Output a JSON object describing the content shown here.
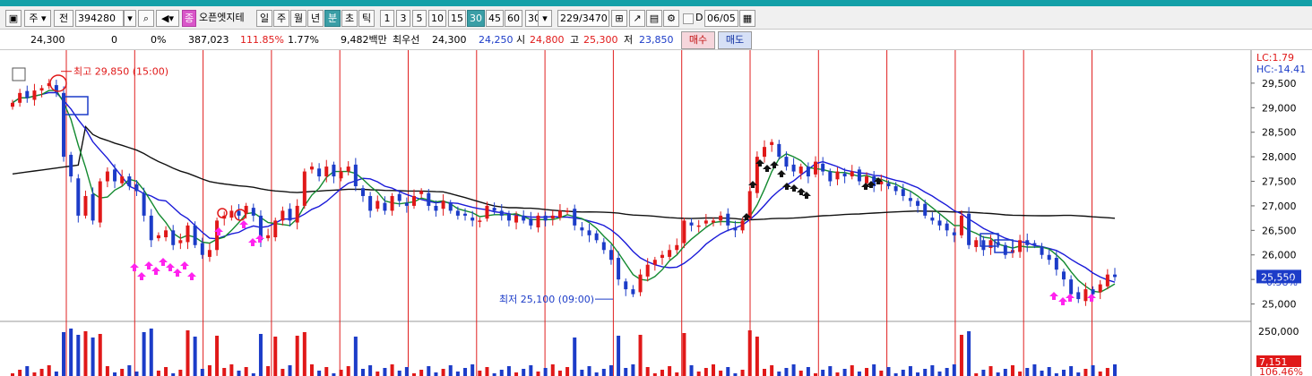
{
  "toolbar": {
    "mode_label": "주",
    "code_type_label": "전",
    "stock_code": "394280",
    "stock_name": "오픈엣지테",
    "badge_label": "종",
    "period_tabs": [
      "일",
      "주",
      "월",
      "년",
      "분",
      "초",
      "틱"
    ],
    "active_period": "분",
    "intervals": [
      "1",
      "3",
      "5",
      "10",
      "15",
      "30",
      "45",
      "60"
    ],
    "active_interval": "30",
    "interval_select_value": "30",
    "count_value": "229",
    "count_total": "/3470",
    "d_label": "D",
    "date_value": "06/05"
  },
  "quote": {
    "price": "24,300",
    "change": "0",
    "change_pct": "0%",
    "volume": "387,023",
    "volume_ratio": "111.85%",
    "turnover": "1.77%",
    "amount": "9,482백만",
    "priority_label": "최우선",
    "ask": "24,300",
    "bid": "24,250",
    "open_label": "시",
    "open": "24,800",
    "high_label": "고",
    "high": "25,300",
    "low_label": "저",
    "low": "23,850",
    "buy_label": "매수",
    "sell_label": "매도"
  },
  "colors": {
    "up": "#e01818",
    "down": "#1c3cc8",
    "accent": "#3a9ea6",
    "ma_short": "#138a30",
    "ma_mid": "#1a1ad8",
    "ma_long": "#111111",
    "signal": "#ff22ee"
  },
  "chart_data": {
    "type": "candlestick",
    "y_axis_ticks": [
      "29,500",
      "29,000",
      "28,500",
      "28,000",
      "27,500",
      "27,000",
      "26,500",
      "26,000",
      "25,500",
      "25,000"
    ],
    "ylim": [
      24700,
      30100
    ],
    "legend_lc": "LC:1.79",
    "legend_hc": "HC:-14.41",
    "current_price_label": "25,550",
    "current_change_label": "-0.58%",
    "current_price": 25550,
    "high_annotation": "최고 29,850 (15:00)",
    "high_value": 29850,
    "low_annotation": "최저 25,100 (09:00)",
    "low_value": 25100,
    "series": [
      {
        "name": "close",
        "values": [
          29100,
          29300,
          29200,
          29350,
          29400,
          29500,
          29300,
          28000,
          27600,
          26800,
          27200,
          26700,
          27500,
          27700,
          27500,
          27600,
          27400,
          27300,
          26800,
          26300,
          26400,
          26500,
          26200,
          26300,
          26600,
          26200,
          26000,
          26100,
          26700,
          26800,
          26900,
          26800,
          27000,
          26800,
          26300,
          26400,
          26700,
          26900,
          26700,
          27000,
          27700,
          27800,
          27600,
          27800,
          27600,
          27700,
          27800,
          27400,
          27200,
          26900,
          27100,
          26900,
          27200,
          27100,
          27000,
          27200,
          27300,
          27000,
          26900,
          27100,
          26900,
          26800,
          26800,
          26700,
          26700,
          27000,
          26900,
          26800,
          26700,
          26800,
          26700,
          26600,
          26800,
          26700,
          26800,
          26900,
          26900,
          26600,
          26500,
          26400,
          26300,
          26100,
          25900,
          25500,
          25300,
          25200,
          25600,
          25800,
          25900,
          26000,
          26100,
          26200,
          26700,
          26600,
          26600,
          26700,
          26700,
          26800,
          26600,
          26500,
          26700,
          27300,
          28000,
          28200,
          28300,
          28000,
          27800,
          27700,
          27800,
          27600,
          27900,
          27700,
          27500,
          27700,
          27600,
          27700,
          27500,
          27600,
          27400,
          27500,
          27400,
          27300,
          27200,
          27100,
          27000,
          26800,
          26700,
          26600,
          26500,
          26400,
          26800,
          26200,
          26300,
          26100,
          26300,
          26200,
          26000,
          26100,
          26300,
          26200,
          26200,
          26000,
          25900,
          25700,
          25500,
          25200,
          25100,
          25300,
          25200,
          25400,
          25600,
          25550
        ]
      }
    ],
    "volume_axis_label": "250,000",
    "volume_value_label": "7,151",
    "volume_pct_label": "106.46%"
  }
}
